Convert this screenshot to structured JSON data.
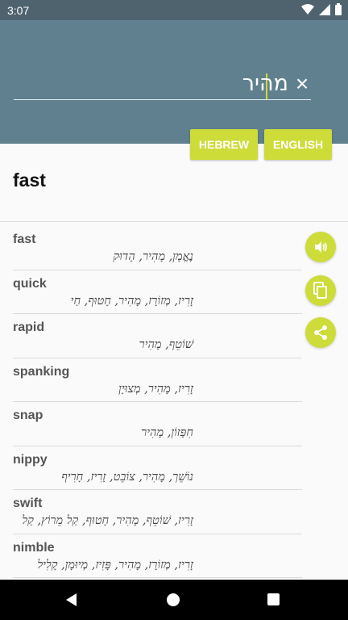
{
  "status": {
    "time": "3:07"
  },
  "search": {
    "query": "מהיר",
    "clear_symbol": "×"
  },
  "language_buttons": {
    "hebrew": "HEBREW",
    "english": "ENGLISH"
  },
  "headword": "fast",
  "results": [
    {
      "word": "fast",
      "translation": "נֶאֱמָן, מָהִיר, הָדוּק"
    },
    {
      "word": "quick",
      "translation": "זָרִיז, מְזוֹרָז, מָהִיר, חָטוּף, חַי"
    },
    {
      "word": "rapid",
      "translation": "שׁוֹטֵף, מָהִיר"
    },
    {
      "word": "spanking",
      "translation": "זָרִיז, מָהִיר, מְצוּיָן"
    },
    {
      "word": "snap",
      "translation": "חִפָּזוֹן, מָהִיר"
    },
    {
      "word": "nippy",
      "translation": "נוֹשֵׁך, מָהִיר, צוֹבֵט, זָרִיז, חָרִיף"
    },
    {
      "word": "swift",
      "translation": "זָרִיז, שׁוֹטֵף, מָהִיר, חָטוּף, קַל מֵרוֹץ, קַל"
    },
    {
      "word": "nimble",
      "translation": "זָרִיז, מְזוֹרָז, מָהִיר, פָּזִיז, מְיוּמָן, קָלִיל"
    }
  ],
  "fab_icons": [
    "speaker-icon",
    "copy-icon",
    "share-icon"
  ],
  "colors": {
    "accent": "#cddc39",
    "header": "#61808f",
    "status_bar": "#4f636e"
  }
}
